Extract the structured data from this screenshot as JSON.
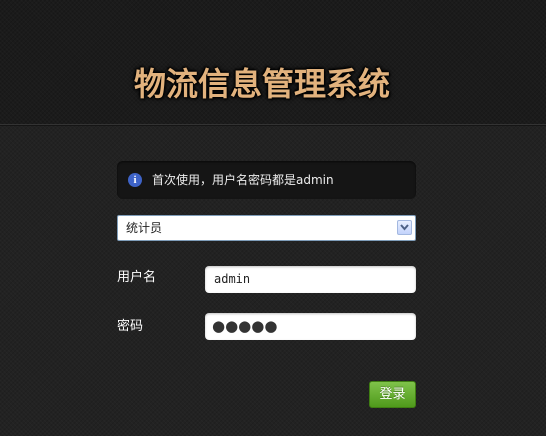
{
  "header": {
    "title": "物流信息管理系统"
  },
  "notice": {
    "icon": "info-icon",
    "icon_glyph": "i",
    "text": "首次使用，用户名密码都是admin"
  },
  "role_select": {
    "selected": "统计员",
    "arrow_icon": "chevron-down-icon"
  },
  "form": {
    "username_label": "用户名",
    "username_value": "admin",
    "password_label": "密码",
    "password_masked": "●●●●●"
  },
  "login_button": {
    "label": "登录"
  },
  "colors": {
    "title": "#e2b27d",
    "background": "#222222",
    "button": "#5fa828",
    "info_icon": "#3e63c7"
  }
}
